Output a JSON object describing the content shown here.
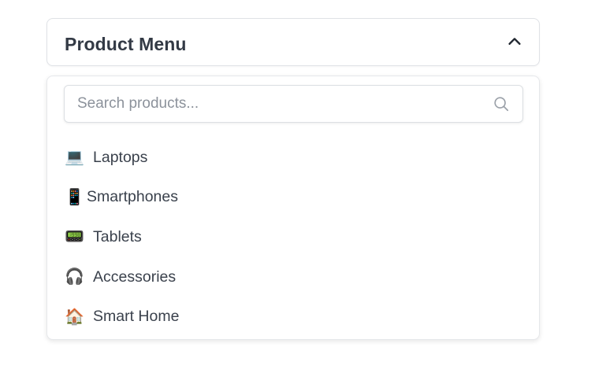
{
  "menu": {
    "title": "Product Menu",
    "expanded": true,
    "toggle_icon": "chevron-up-icon"
  },
  "search": {
    "placeholder": "Search products...",
    "value": "",
    "icon": "search-icon"
  },
  "items": [
    {
      "label": "Laptops",
      "icon": "💻",
      "icon_name": "laptop-icon"
    },
    {
      "label": "Smartphones",
      "icon": "📱",
      "icon_name": "smartphone-icon"
    },
    {
      "label": "Tablets",
      "icon": "📟",
      "icon_name": "tablet-icon"
    },
    {
      "label": "Accessories",
      "icon": "🎧",
      "icon_name": "headphones-icon"
    },
    {
      "label": "Smart Home",
      "icon": "🏠",
      "icon_name": "house-icon"
    }
  ],
  "colors": {
    "title": "#333a45",
    "text": "#3a414c",
    "placeholder": "#8c929b",
    "border": "#dfe2e6"
  }
}
